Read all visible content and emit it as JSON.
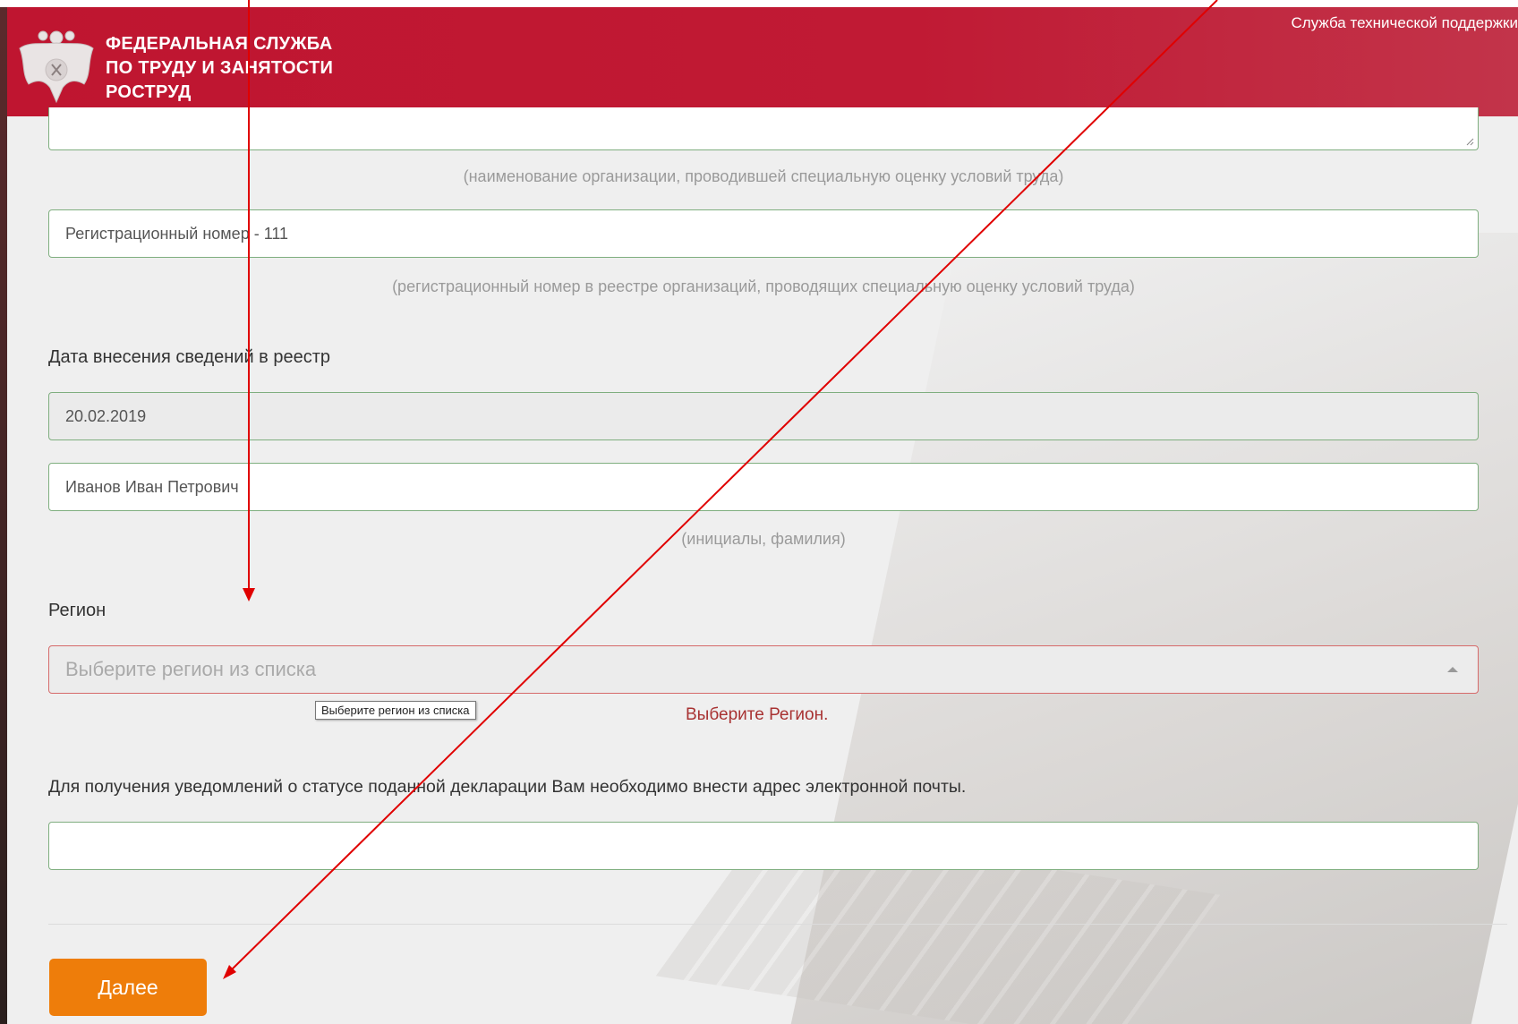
{
  "header": {
    "brand_line1": "ФЕДЕРАЛЬНАЯ СЛУЖБА",
    "brand_line2": "ПО ТРУДУ И ЗАНЯТОСТИ",
    "brand_line3": "РОСТРУД",
    "support_link": "Служба технической поддержки",
    "color": "#bf1530"
  },
  "form": {
    "organization_hint": "(наименование организации, проводившей специальную оценку условий труда)",
    "registration_number_value": "Регистрационный номер - 111",
    "registration_number_hint": "(регистрационный номер в реестре организаций, проводящих специальную оценку условий труда)",
    "registry_date_label": "Дата внесения сведений в реестр",
    "registry_date_value": "20.02.2019",
    "full_name_value": "Иванов Иван Петрович",
    "full_name_hint": "(инициалы, фамилия)",
    "region_label": "Регион",
    "region_placeholder": "Выберите регион из списка",
    "region_tooltip": "Выберите регион из списка",
    "region_error": "Выберите Регион.",
    "email_label": "Для получения уведомлений о статусе поданной декларации Вам необходимо внести адрес электронной почты.",
    "email_value": "",
    "next_button": "Далее"
  },
  "annotation": {
    "arrow_color": "#e00000"
  }
}
